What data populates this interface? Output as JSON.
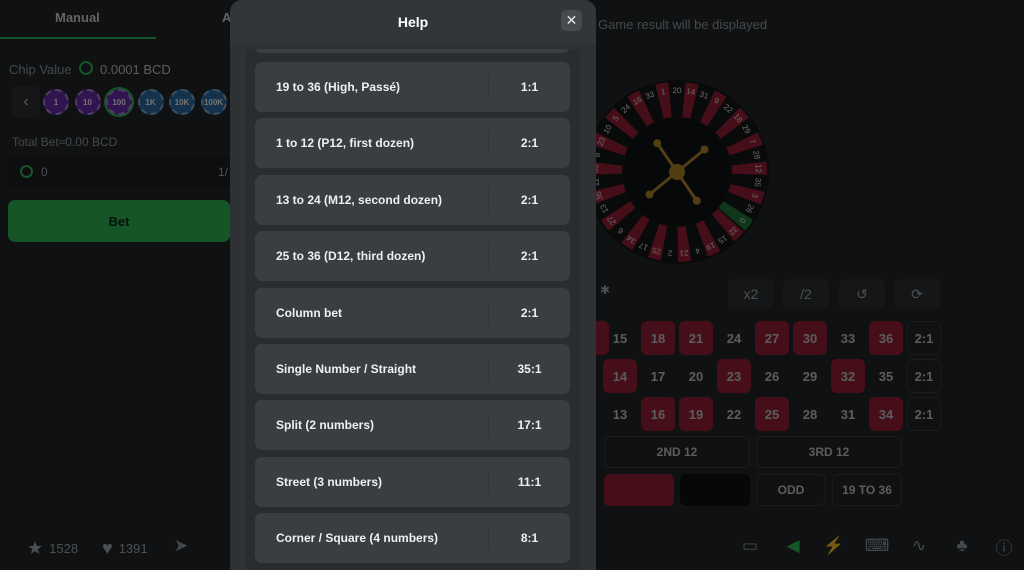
{
  "left": {
    "tabs": [
      "Manual",
      "A"
    ],
    "chip_value_label": "Chip Value",
    "chip_value": "0.0001 BCD",
    "chips": [
      {
        "label": "1",
        "color": "#6a2fb5"
      },
      {
        "label": "10",
        "color": "#6a2fb5"
      },
      {
        "label": "100",
        "color": "#6a2fb5",
        "selected": true
      },
      {
        "label": "1K",
        "color": "#2f6ea8"
      },
      {
        "label": "10K",
        "color": "#2f6ea8"
      },
      {
        "label": "100K",
        "color": "#2f6ea8"
      }
    ],
    "total_bet": "Total Bet≈0.00 BCD",
    "amount": "0",
    "amount_right": "1/",
    "bet_button": "Bet"
  },
  "game_result_text": "Game result will be displayed",
  "wheel_order": [
    0,
    32,
    15,
    19,
    4,
    21,
    2,
    25,
    17,
    34,
    6,
    27,
    13,
    36,
    11,
    30,
    8,
    23,
    10,
    5,
    24,
    16,
    33,
    1,
    20,
    14,
    31,
    9,
    22,
    18,
    29,
    7,
    28,
    12,
    35,
    3,
    26
  ],
  "red_numbers": [
    1,
    3,
    5,
    7,
    9,
    12,
    14,
    16,
    18,
    19,
    21,
    23,
    25,
    27,
    30,
    32,
    34,
    36
  ],
  "controls": [
    "x2",
    "/2",
    "↺",
    "⟳"
  ],
  "board": {
    "rows": [
      [
        "15",
        "18",
        "21",
        "24",
        "27",
        "30",
        "33",
        "36"
      ],
      [
        "14",
        "17",
        "20",
        "23",
        "26",
        "29",
        "32",
        "35"
      ],
      [
        "13",
        "16",
        "19",
        "22",
        "25",
        "28",
        "31",
        "34"
      ]
    ],
    "column_label": "2:1",
    "dozens": [
      "2ND 12",
      "3RD 12"
    ],
    "outside": [
      "ODD",
      "19 TO 36"
    ]
  },
  "footer": {
    "likes": "1528",
    "hearts": "1391"
  },
  "colors": {
    "accent": "#2ebd59",
    "red": "#9c2035",
    "green": "#1f7a3c"
  },
  "modal": {
    "title": "Help",
    "close": "✕",
    "rows": [
      {
        "name": "19 to 36 (High, Passé)",
        "payout": "1:1"
      },
      {
        "name": "1 to 12 (P12, first dozen)",
        "payout": "2:1"
      },
      {
        "name": "13 to 24 (M12, second dozen)",
        "payout": "2:1"
      },
      {
        "name": "25 to 36 (D12, third dozen)",
        "payout": "2:1"
      },
      {
        "name": "Column bet",
        "payout": "2:1"
      },
      {
        "name": "Single Number / Straight",
        "payout": "35:1"
      },
      {
        "name": "Split (2 numbers)",
        "payout": "17:1"
      },
      {
        "name": "Street (3 numbers)",
        "payout": "11:1"
      },
      {
        "name": "Corner / Square (4 numbers)",
        "payout": "8:1"
      }
    ]
  }
}
